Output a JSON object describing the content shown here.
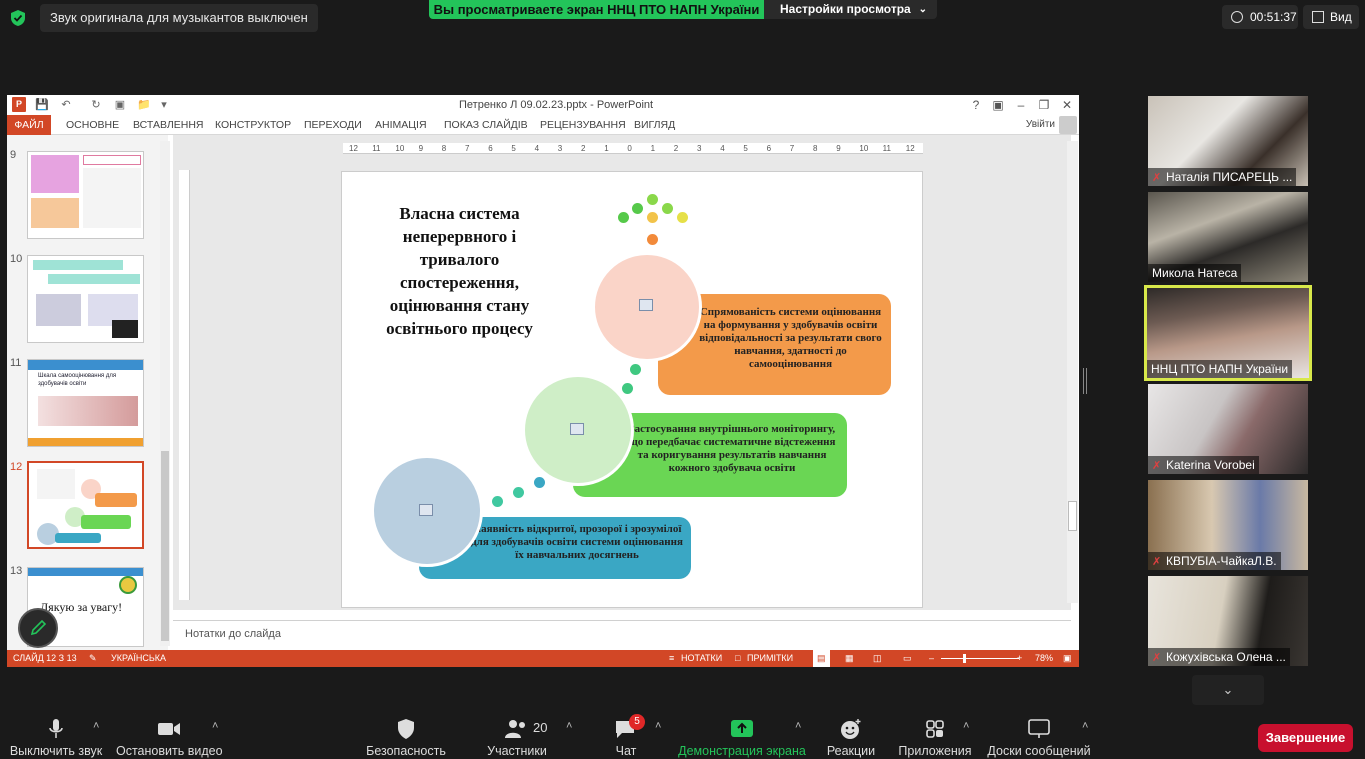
{
  "zoom_top": {
    "notice": "Звук оригинала для музыкантов выключен",
    "share_banner": "Вы просматриваете экран ННЦ ПТО НАПН України",
    "view_options": "Настройки просмотра",
    "timer": "00:51:37",
    "view": "Вид"
  },
  "ppt": {
    "title": "Петренко Л 09.02.23.pptx - PowerPoint",
    "tabs": [
      "ФАЙЛ",
      "ОСНОВНЕ",
      "ВСТАВЛЕННЯ",
      "КОНСТРУКТОР",
      "ПЕРЕХОДИ",
      "АНІМАЦІЯ",
      "ПОКАЗ СЛАЙДІВ",
      "РЕЦЕНЗУВАННЯ",
      "ВИГЛЯД"
    ],
    "signin": "Увійти",
    "slide_numbers": [
      "9",
      "10",
      "11",
      "12",
      "13"
    ],
    "thumb11_title": "Шкала самооцінювання для здобувачів освіти",
    "thumb13_text": "Дякую за увагу!",
    "ruler_labels": [
      "12",
      "11",
      "10",
      "9",
      "8",
      "7",
      "6",
      "5",
      "4",
      "3",
      "2",
      "1",
      "0",
      "1",
      "2",
      "3",
      "4",
      "5",
      "6",
      "7",
      "8",
      "9",
      "10",
      "11",
      "12"
    ],
    "notes_placeholder": "Нотатки до слайда",
    "status": {
      "slide": "СЛАЙД 12 З 13",
      "language": "УКРАЇНСЬКА",
      "notes": "НОТАТКИ",
      "comments": "ПРИМІТКИ",
      "zoom": "78%"
    },
    "slide": {
      "title": "Власна система неперервного і тривалого спостереження, оцінювання стану освітнього процесу",
      "box_orange": "Спрямованість системи оцінювання на формування у здобувачів освіти відповідальності за результати свого навчання, здатності до самооцінювання",
      "box_green": "Застосування внутрішнього моніторингу, що передбачає систематичне відстеження та коригування результатів навчання кожного здобувача освіти",
      "box_blue": "Наявність відкритої, прозорої і зрозумілої для здобувачів освіти системи оцінювання їх навчальних досягнень"
    }
  },
  "participants": [
    {
      "name": "Наталія ПИСАРЕЦЬ ...",
      "muted": true
    },
    {
      "name": "Микола Натеса",
      "muted": false
    },
    {
      "name": "ННЦ ПТО НАПН України",
      "muted": false
    },
    {
      "name": "Katerina Vorobei",
      "muted": true
    },
    {
      "name": "КВПУБІА-ЧайкаЛ.В.",
      "muted": true
    },
    {
      "name": "Кожухівська Олена ...",
      "muted": true
    }
  ],
  "toolbar": {
    "mute": "Выключить звук",
    "video": "Остановить видео",
    "security": "Безопасность",
    "participants": "Участники",
    "participants_count": "20",
    "chat": "Чат",
    "chat_badge": "5",
    "share": "Демонстрация экрана",
    "reactions": "Реакции",
    "apps": "Приложения",
    "whiteboards": "Доски сообщений",
    "end": "Завершение"
  },
  "colors": {
    "zoom_green": "#23c45a",
    "ppt_accent": "#d24726",
    "end_red": "#c8102e",
    "active_speaker": "#d8e84a"
  }
}
